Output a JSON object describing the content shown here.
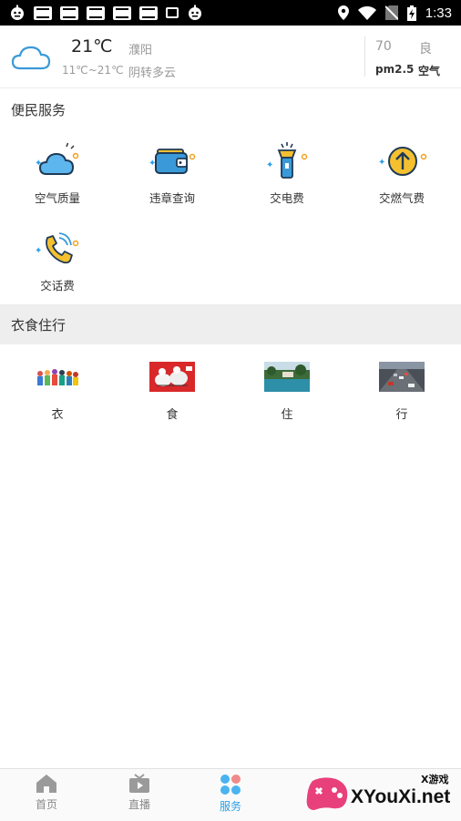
{
  "status_bar": {
    "time": "1:33",
    "notification_icons": [
      "robot-icon",
      "toutiao-icon",
      "toutiao-icon",
      "toutiao-icon",
      "toutiao-icon",
      "toutiao-icon",
      "image-icon",
      "robot-icon"
    ],
    "system_icons": [
      "location-icon",
      "wifi-icon",
      "no-sim-icon",
      "battery-charging-icon"
    ]
  },
  "weather": {
    "icon": "cloud-icon",
    "temperature": "21℃",
    "range": "11℃~21℃",
    "city": "濮阳",
    "condition": "阴转多云",
    "aqi_value": "70",
    "aqi_level": "良",
    "pm_label": "pm2.5",
    "air_label": "空气"
  },
  "services": {
    "title": "便民服务",
    "items": [
      {
        "label": "空气质量",
        "icon": "cloud-icon"
      },
      {
        "label": "违章查询",
        "icon": "wallet-icon"
      },
      {
        "label": "交电费",
        "icon": "flashlight-icon"
      },
      {
        "label": "交燃气费",
        "icon": "arrow-up-circle-icon"
      },
      {
        "label": "交话费",
        "icon": "phone-icon"
      }
    ]
  },
  "life": {
    "title": "衣食住行",
    "items": [
      {
        "label": "衣"
      },
      {
        "label": "食"
      },
      {
        "label": "住"
      },
      {
        "label": "行"
      }
    ]
  },
  "bottom_nav": {
    "items": [
      {
        "label": "首页",
        "icon": "home-icon",
        "active": false
      },
      {
        "label": "直播",
        "icon": "tv-icon",
        "active": false
      },
      {
        "label": "服务",
        "icon": "services-icon",
        "active": true
      }
    ],
    "active_color": "#2aa0e6"
  },
  "watermark": {
    "text": "XYouXi.net",
    "small_text": "X游戏"
  }
}
